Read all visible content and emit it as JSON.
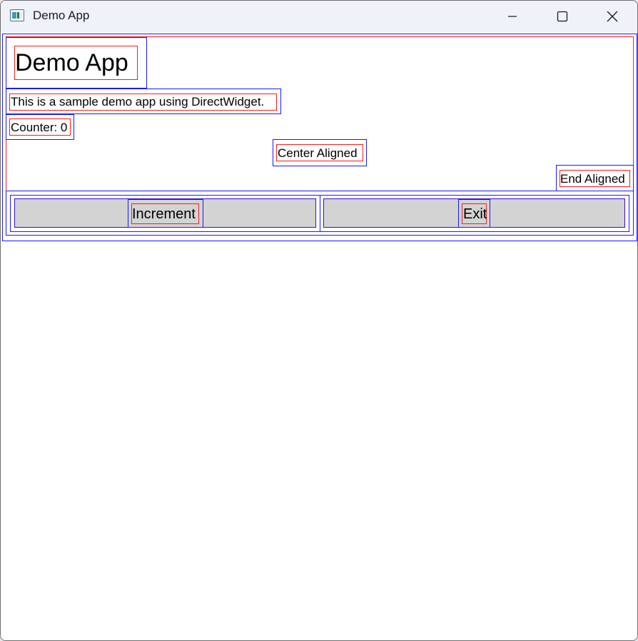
{
  "window": {
    "title": "Demo App",
    "icon": "app-window-icon",
    "controls": {
      "minimize_icon": "minimize-icon",
      "maximize_icon": "maximize-icon",
      "close_icon": "close-icon"
    }
  },
  "content": {
    "heading": "Demo App",
    "description": "This is a sample demo app using DirectWidget.",
    "counter_label": "Counter: 0",
    "center_label": "Center Aligned",
    "end_label": "End Aligned"
  },
  "buttons": {
    "increment_label": "Increment",
    "exit_label": "Exit"
  },
  "colors": {
    "debug_outer": "#1a1aff",
    "debug_inner": "#ff1a1a",
    "button_fill": "#d3d3d3",
    "button_border": "#3a0ad9",
    "titlebar": "#eff2f8"
  }
}
